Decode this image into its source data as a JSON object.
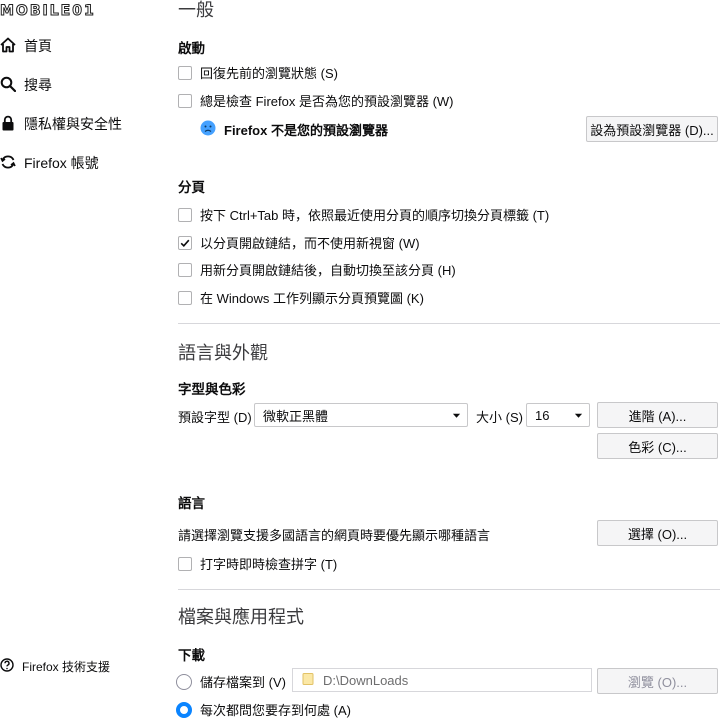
{
  "logo": {
    "text": "MOBILE01"
  },
  "sidebar": {
    "items": [
      {
        "label": "首頁",
        "icon": "home-icon"
      },
      {
        "label": "搜尋",
        "icon": "search-icon"
      },
      {
        "label": "隱私權與安全性",
        "icon": "lock-icon"
      },
      {
        "label": "Firefox 帳號",
        "icon": "sync-icon"
      }
    ],
    "support": {
      "label": "Firefox 技術支援",
      "icon": "help-icon"
    }
  },
  "general": {
    "title": "一般",
    "startup": {
      "heading": "啟動",
      "restore_session": {
        "label": "回復先前的瀏覽狀態 (S)",
        "checked": false
      },
      "check_default": {
        "label": "總是檢查 Firefox 是否為您的預設瀏覽器 (W)",
        "checked": false
      },
      "default_status": "Firefox 不是您的預設瀏覽器",
      "make_default_button": "設為預設瀏覽器 (D)..."
    },
    "tabs": {
      "heading": "分頁",
      "options": [
        {
          "label": "按下 Ctrl+Tab 時，依照最近使用分頁的順序切換分頁標籤 (T)",
          "checked": false
        },
        {
          "label": "以分頁開啟鏈結，而不使用新視窗 (W)",
          "checked": true
        },
        {
          "label": "用新分頁開啟鏈結後，自動切換至該分頁 (H)",
          "checked": false
        },
        {
          "label": "在 Windows 工作列顯示分頁預覽圖 (K)",
          "checked": false
        }
      ]
    }
  },
  "language_appearance": {
    "title": "語言與外觀",
    "fonts": {
      "heading": "字型與色彩",
      "default_font_label": "預設字型 (D)",
      "default_font_value": "微軟正黑體",
      "size_label": "大小 (S)",
      "size_value": "16",
      "advanced_button": "進階 (A)...",
      "colors_button": "色彩 (C)..."
    },
    "language": {
      "heading": "語言",
      "description": "請選擇瀏覽支援多國語言的網頁時要優先顯示哪種語言",
      "choose_button": "選擇 (O)...",
      "spellcheck": {
        "label": "打字時即時檢查拼字 (T)",
        "checked": false
      }
    }
  },
  "files_apps": {
    "title": "檔案與應用程式",
    "downloads": {
      "heading": "下載",
      "save_to_label": "儲存檔案到 (V)",
      "path": "D:\\DownLoads",
      "browse_button": "瀏覽 (O)...",
      "ask_label": "每次都問您要存到何處 (A)"
    }
  },
  "colors": {
    "accent": "#0a84ff",
    "warning": "#45a1ff",
    "separator": "#d7d7db"
  }
}
